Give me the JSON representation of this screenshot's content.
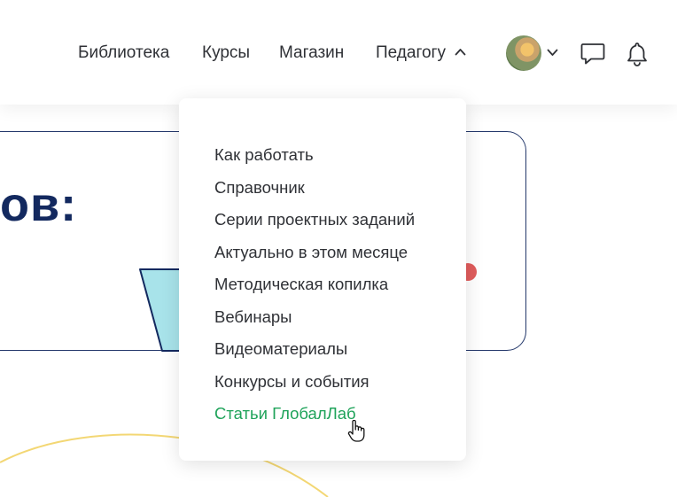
{
  "nav": {
    "items": [
      {
        "label": "Библиотека"
      },
      {
        "label": "Курсы"
      },
      {
        "label": "Магазин"
      },
      {
        "label": "Педагогу"
      }
    ],
    "expanded_icon": "chevron-up-icon"
  },
  "user": {
    "avatar_icon": "avatar",
    "menu_icon": "chevron-down-icon"
  },
  "icons": {
    "messages": "chat-bubble-icon",
    "notifications": "bell-icon"
  },
  "background": {
    "heading_fragment": "ов:"
  },
  "dropdown": {
    "items": [
      {
        "label": "Как работать"
      },
      {
        "label": "Справочник"
      },
      {
        "label": "Серии проектных заданий"
      },
      {
        "label": "Актуально в этом месяце"
      },
      {
        "label": "Методическая копилка"
      },
      {
        "label": "Вебинары"
      },
      {
        "label": "Видеоматериалы"
      },
      {
        "label": "Конкурсы и события"
      },
      {
        "label": "Статьи ГлобалЛаб",
        "hovered": true
      }
    ]
  },
  "colors": {
    "text": "#2f3136",
    "accent_green": "#1fa35a",
    "heading_navy": "#13295f",
    "card_border": "#24386b",
    "shape_cyan": "#a8e3ea",
    "dot_red": "#e05c5c",
    "arc_yellow": "#f3d774"
  }
}
